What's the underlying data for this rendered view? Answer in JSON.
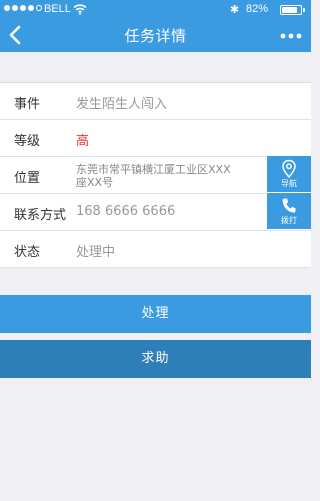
{
  "status_bar": {
    "carrier": "BELL",
    "battery_percent": "82%",
    "battery_level": 0.82,
    "signal_bars_filled": 4,
    "signal_bars_total": 5
  },
  "nav": {
    "title": "任务详情"
  },
  "form": {
    "event": {
      "label": "事件",
      "value": "发生陌生人闯入"
    },
    "level": {
      "label": "等级",
      "value": "高"
    },
    "location": {
      "label": "位置",
      "value": "东莞市常平镇横江厦工业区XXX座XX号"
    },
    "contact": {
      "label": "联系方式",
      "value": "168 6666 6666"
    },
    "status": {
      "label": "状态",
      "value": "处理中"
    }
  },
  "side_buttons": {
    "navigate": "导航",
    "call": "拨打"
  },
  "actions": {
    "process": "处理",
    "help": "求助"
  },
  "colors": {
    "primary": "#3a9be0",
    "secondary": "#2e7fb8",
    "alert": "#e53434",
    "background": "#efeff4"
  }
}
